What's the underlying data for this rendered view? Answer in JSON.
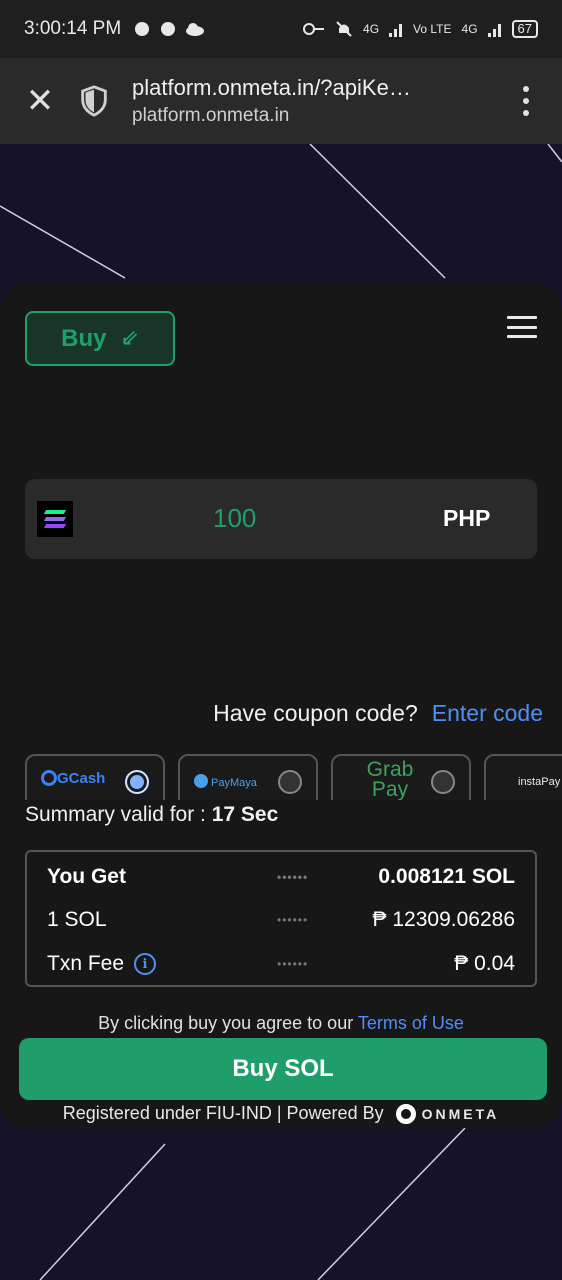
{
  "status_bar": {
    "time": "3:00:14 PM",
    "network_1": "4G",
    "network_2": "Vo LTE",
    "network_3": "4G",
    "battery": "67"
  },
  "browser": {
    "url_title": "platform.onmeta.in/?apiKe…",
    "url_domain": "platform.onmeta.in"
  },
  "tabs": {
    "buy_label": "Buy",
    "buy_arrow": "⇙"
  },
  "amount": {
    "value": "100",
    "currency": "PHP",
    "token_icon": "solana-icon"
  },
  "coupon": {
    "question": "Have coupon code?",
    "link": "Enter code"
  },
  "payment_methods": [
    {
      "name": "GCash",
      "selected": true
    },
    {
      "name": "PayMaya",
      "selected": false
    },
    {
      "name": "Grab Pay",
      "selected": false
    },
    {
      "name": "instaPay",
      "selected": false
    }
  ],
  "summary": {
    "valid_label": "Summary valid for :",
    "valid_value": "17 Sec",
    "rows": [
      {
        "label": "You Get",
        "dots": "••••••",
        "value": "0.008121 SOL"
      },
      {
        "label": "1 SOL",
        "dots": "••••••",
        "value": "₱ 12309.06286"
      },
      {
        "label": "Txn Fee",
        "dots": "••••••",
        "value": "₱ 0.04"
      }
    ],
    "info_icon": "i"
  },
  "terms": {
    "prefix": "By clicking buy you agree to our",
    "link": "Terms of Use"
  },
  "cta": {
    "label": "Buy SOL"
  },
  "footer": {
    "text": "Registered under FIU-IND | Powered By",
    "brand": "ONMETA"
  },
  "colors": {
    "accent_green": "#1fa06b",
    "link_blue": "#4f8ef7",
    "card_bg": "#171717",
    "page_bg": "#161329"
  }
}
